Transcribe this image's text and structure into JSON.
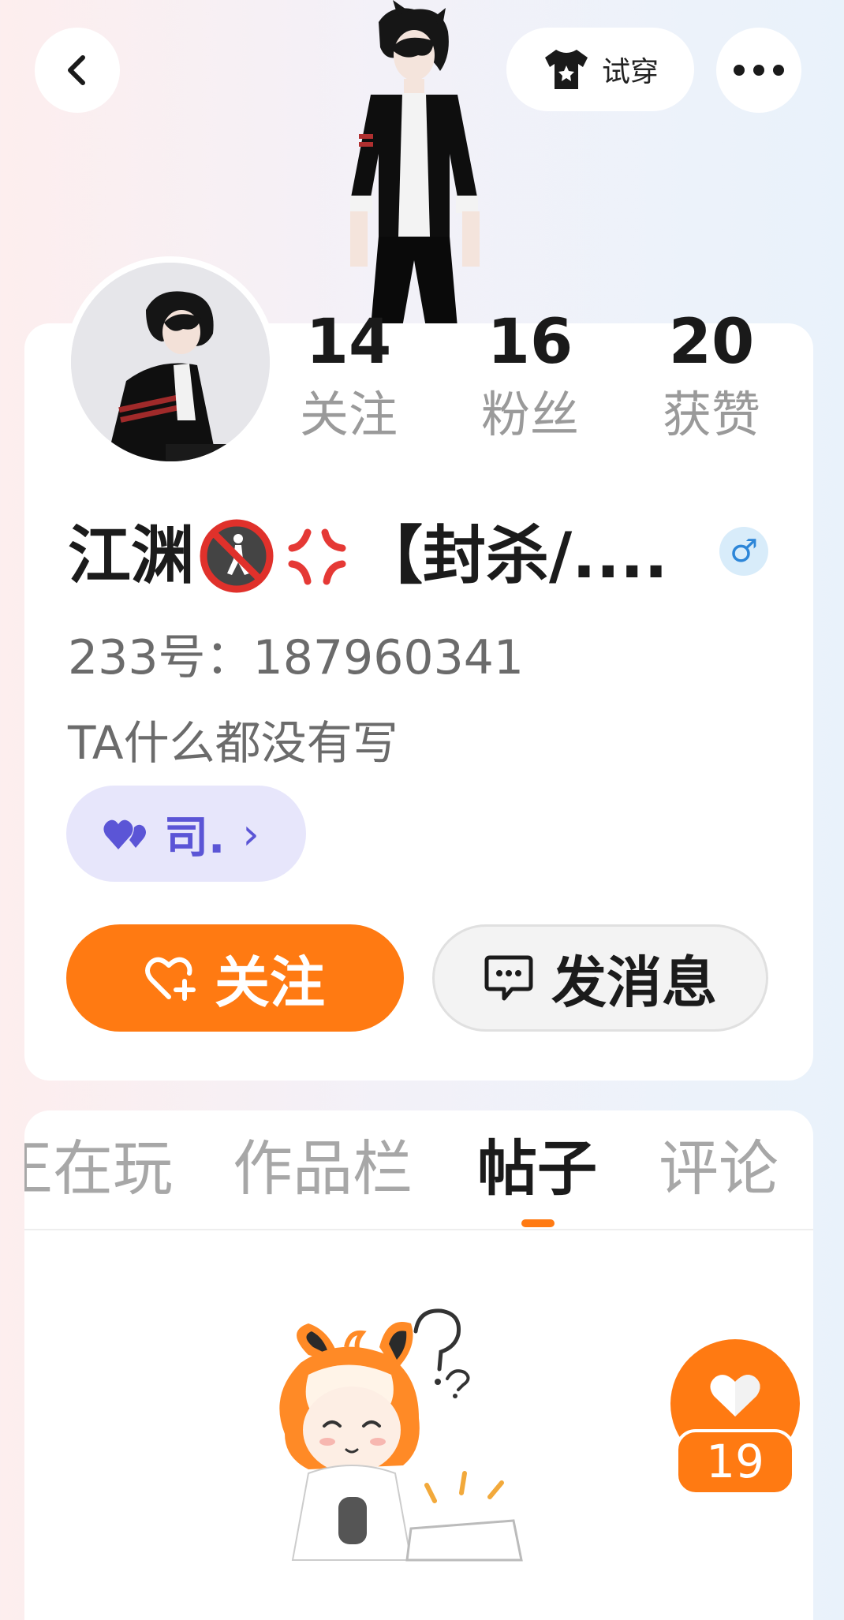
{
  "header": {
    "back_icon": "chevron-left-icon",
    "tryon_label": "试穿",
    "tryon_icon": "tshirt-icon",
    "more_icon": "more-dots-icon"
  },
  "profile": {
    "stats": [
      {
        "value": "14",
        "label": "关注"
      },
      {
        "value": "16",
        "label": "粉丝"
      },
      {
        "value": "20",
        "label": "获赞"
      }
    ],
    "nickname": "江渊🚷💢【封杀/....",
    "nickname_text": "江渊",
    "nickname_suffix": "【封杀/....",
    "gender": "♂",
    "uid": "233号：187960341",
    "bio": "TA什么都没有写",
    "tag": {
      "icon": "double-heart-icon",
      "text": "司.",
      "chevron": "›"
    },
    "follow_label": "关注",
    "message_label": "发消息"
  },
  "feed": {
    "tabs": [
      {
        "label": "正在玩",
        "active": false
      },
      {
        "label": "作品栏",
        "active": false
      },
      {
        "label": "帖子",
        "active": true
      },
      {
        "label": "评论",
        "active": false
      }
    ],
    "like_count": "19"
  },
  "colors": {
    "accent": "#ff7a12",
    "tag_bg": "#e7e6fb",
    "tag_text": "#5b55d6",
    "gender_bg": "#d8ecfa",
    "gender_text": "#2d86d8"
  }
}
